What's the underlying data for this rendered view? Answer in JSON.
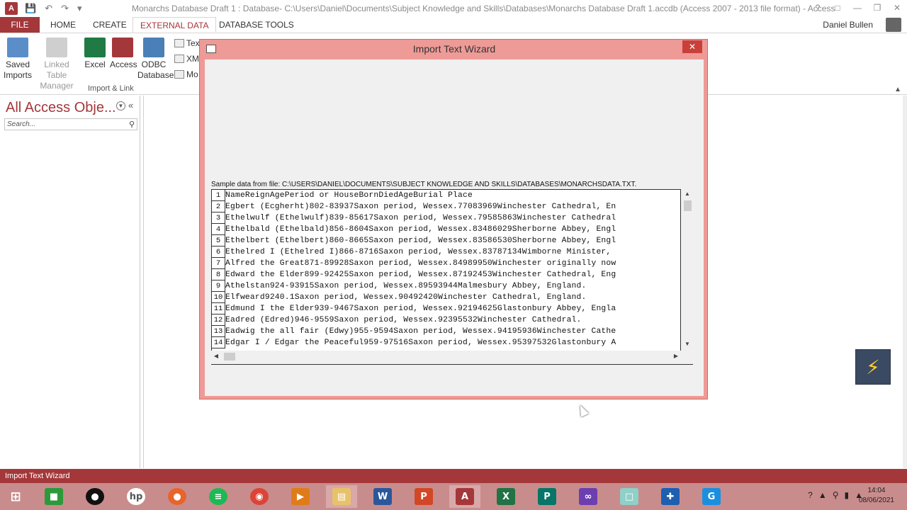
{
  "window": {
    "app_icon": "A",
    "title": "Monarchs Database Draft 1 : Database- C:\\Users\\Daniel\\Documents\\Subject Knowledge and Skills\\Databases\\Monarchs Database Draft 1.accdb (Access 2007 - 2013 file format) - Access",
    "help": "?",
    "minimize": "—",
    "restore": "❐",
    "close": "✕"
  },
  "ribbon_tabs": {
    "file": "FILE",
    "home": "HOME",
    "create": "CREATE",
    "external_data": "EXTERNAL DATA",
    "database_tools": "DATABASE TOOLS"
  },
  "user": {
    "name": "Daniel Bullen"
  },
  "ribbon": {
    "saved_imports": "Saved Imports",
    "saved_imports_l1": "Saved",
    "saved_imports_l2": "Imports",
    "linked_table_l1": "Linked Table",
    "linked_table_l2": "Manager",
    "excel": "Excel",
    "access": "Access",
    "odbc_l1": "ODBC",
    "odbc_l2": "Database",
    "text_file": "Tex",
    "xml_file": "XM",
    "more": "Mo",
    "group_label": "Import & Link"
  },
  "nav_pane": {
    "title": "All Access Obje...",
    "search_placeholder": "Search..."
  },
  "dialog": {
    "title": "Import Text Wizard",
    "close": "✕",
    "sample_label": "Sample data from file: C:\\USERS\\DANIEL\\DOCUMENTS\\SUBJECT KNOWLEDGE AND SKILLS\\DATABASES\\MONARCHSDATA.TXT.",
    "rows": [
      {
        "n": "1",
        "text": "NameReignAgePeriod or HouseBornDiedAgeBurial Place"
      },
      {
        "n": "2",
        "text": "Egbert (Ecgherht)802-83937Saxon period, Wessex.77083969Winchester Cathedral, En"
      },
      {
        "n": "3",
        "text": "Ethelwulf (Ethelwulf)839-85617Saxon period, Wessex.79585863Winchester Cathedral"
      },
      {
        "n": "4",
        "text": "Ethelbald (Ethelbald)856-8604Saxon period, Wessex.83486029Sherborne Abbey, Engl"
      },
      {
        "n": "5",
        "text": "Ethelbert (Ethelbert)860-8665Saxon period, Wessex.83586530Sherborne Abbey, Engl"
      },
      {
        "n": "6",
        "text": "Ethelred I (Ethelred I)866-8716Saxon period, Wessex.83787134Wimborne Minister,"
      },
      {
        "n": "7",
        "text": "Alfred the Great871-89928Saxon period, Wessex.84989950Winchester originally now"
      },
      {
        "n": "8",
        "text": "Edward the Elder899-92425Saxon period, Wessex.87192453Winchester Cathedral, Eng"
      },
      {
        "n": "9",
        "text": "Athelstan924-93915Saxon period, Wessex.89593944Malmesbury Abbey, England."
      },
      {
        "n": "10",
        "text": "Elfweard9240.1Saxon period, Wessex.90492420Winchester Cathedral, England."
      },
      {
        "n": "11",
        "text": "Edmund I the Elder939-9467Saxon period, Wessex.92194625Glastonbury Abbey, Engla"
      },
      {
        "n": "12",
        "text": "Eadred (Edred)946-9559Saxon period, Wessex.92395532Winchester Cathedral."
      },
      {
        "n": "13",
        "text": "Eadwig the all fair (Edwy)955-9594Saxon period, Wessex.94195936Winchester Cathe"
      },
      {
        "n": "14",
        "text": "Edgar I / Edgar the Peaceful959-97516Saxon period, Wessex.95397532Glastonbury A"
      }
    ]
  },
  "status_bar": {
    "text": "Import Text Wizard"
  },
  "taskbar": {
    "clock_time": "14:04",
    "clock_date": "08/06/2021"
  },
  "colors": {
    "access_accent": "#a4373a",
    "dialog_frame": "#ee9a96",
    "taskbar": "#c98c8c"
  }
}
